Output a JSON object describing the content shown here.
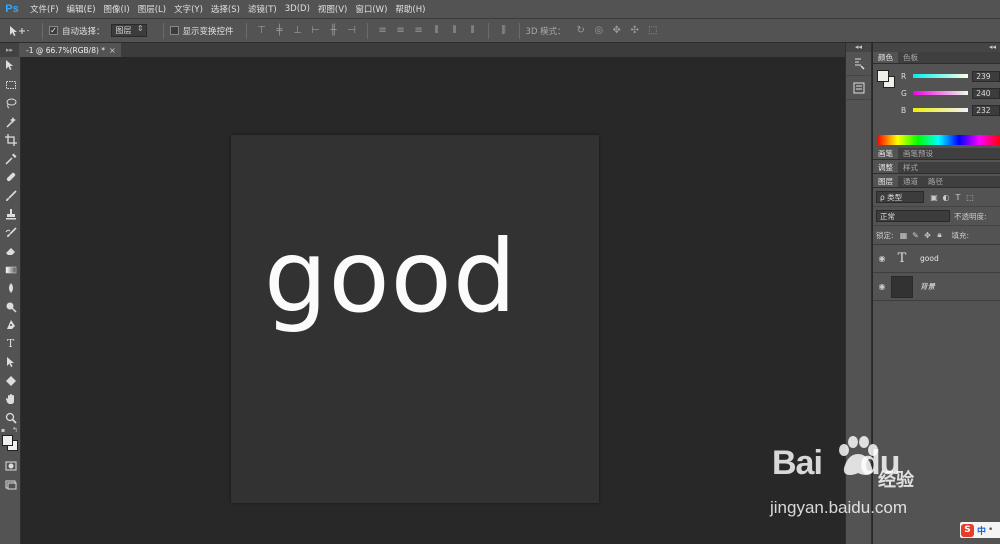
{
  "app": {
    "logo": "Ps"
  },
  "menu": [
    "文件(F)",
    "编辑(E)",
    "图像(I)",
    "图层(L)",
    "文字(Y)",
    "选择(S)",
    "滤镜(T)",
    "3D(D)",
    "视图(V)",
    "窗口(W)",
    "帮助(H)"
  ],
  "options": {
    "auto_select_label": "自动选择：",
    "auto_select_value": "图层",
    "show_transform_label": "显示变换控件",
    "mode_3d_label": "3D 模式："
  },
  "document": {
    "tab_title": "-1 @ 66.7%(RGB/8) *",
    "close": "×",
    "canvas_text": "good"
  },
  "color_panel": {
    "tabs": [
      "颜色",
      "色板"
    ],
    "r_label": "R",
    "r_value": "239",
    "g_label": "G",
    "g_value": "240",
    "b_label": "B",
    "b_value": "232",
    "fg_color": "#efefe8"
  },
  "brush_tabs": [
    "画笔",
    "画笔预设"
  ],
  "adjust_tabs": [
    "调整",
    "样式"
  ],
  "layers_panel": {
    "tabs": [
      "图层",
      "通道",
      "路径"
    ],
    "filter_label": "ρ 类型",
    "blend_mode": "正常",
    "opacity_label": "不透明度:",
    "lock_label": "锁定:",
    "fill_label": "填充:",
    "layers": [
      {
        "name": "good",
        "type": "text"
      },
      {
        "name": "背景",
        "type": "background"
      }
    ]
  },
  "watermark": {
    "brand": "Bai",
    "brand2": "du",
    "cn": "经验",
    "url": "jingyan.baidu.com"
  },
  "ime": {
    "s": "S",
    "zh": "中",
    "dot": "•"
  }
}
